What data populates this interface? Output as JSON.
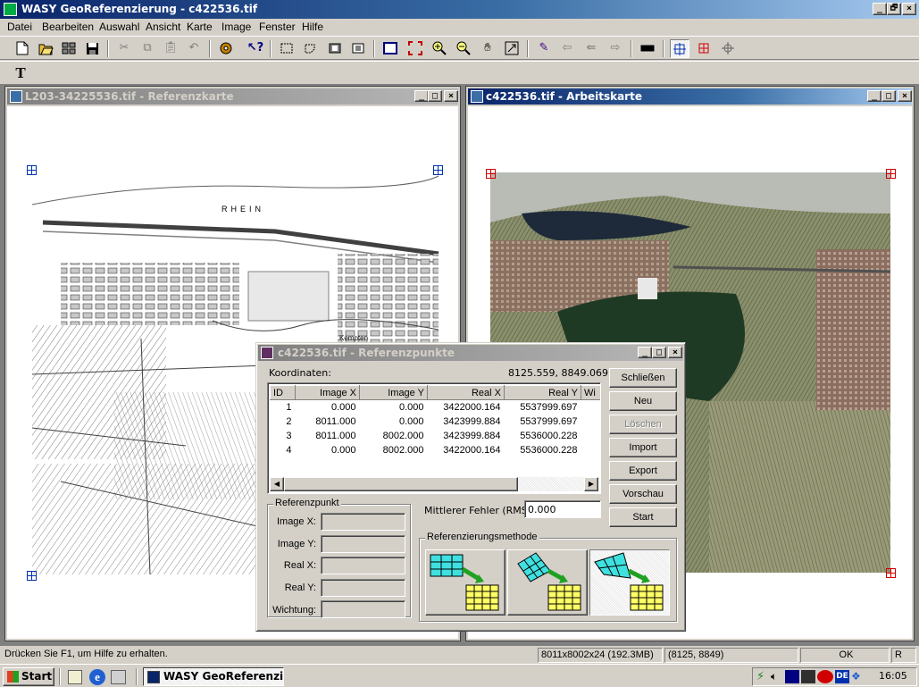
{
  "app": {
    "title": "WASY GeoReferenzierung - c422536.tif",
    "caption_buttons": [
      "_",
      "🗗",
      "×"
    ]
  },
  "menu": [
    "Datei",
    "Bearbeiten",
    "Auswahl",
    "Ansicht",
    "Karte",
    "Image",
    "Fenster",
    "Hilfe"
  ],
  "toolbar": {
    "icons": [
      "new-file-icon",
      "open-folder-icon",
      "layout-icon",
      "save-icon",
      "cut-icon",
      "copy-icon",
      "paste-icon",
      "undo-icon",
      "settings-icon",
      "help-cursor-icon",
      "rect-select-icon",
      "lasso-select-icon",
      "select-in-icon",
      "select-out-icon",
      "fit-window-icon",
      "full-extent-icon",
      "zoom-in-icon",
      "zoom-out-icon",
      "pan-hand-icon",
      "zoom-box-icon",
      "pen-icon",
      "back-icon",
      "back-all-icon",
      "forward-icon",
      "ruler-icon",
      "georef-point-icon",
      "red-point-icon",
      "crosshair-icon"
    ],
    "text_tool_label": "T"
  },
  "reference_window": {
    "title": "L203-34225536.tif - Referenzkarte",
    "map_label": "RHEIN",
    "map_label_2": "Kempten"
  },
  "work_window": {
    "title": "c422536.tif - Arbeitskarte"
  },
  "dialog": {
    "title": "c422536.tif - Referenzpunkte",
    "koordinaten_label": "Koordinaten:",
    "koordinaten_value": "8125.559, 8849.069",
    "columns": [
      "ID",
      "Image X",
      "Image Y",
      "Real X",
      "Real Y",
      "Wi"
    ],
    "rows": [
      [
        "1",
        "0.000",
        "0.000",
        "3422000.164",
        "5537999.697"
      ],
      [
        "2",
        "8011.000",
        "0.000",
        "3423999.884",
        "5537999.697"
      ],
      [
        "3",
        "8011.000",
        "8002.000",
        "3423999.884",
        "5536000.228"
      ],
      [
        "4",
        "0.000",
        "8002.000",
        "3422000.164",
        "5536000.228"
      ]
    ],
    "buttons": {
      "schliessen": "Schließen",
      "neu": "Neu",
      "loeschen": "Löschen",
      "import": "Import",
      "export": "Export",
      "vorschau": "Vorschau",
      "start": "Start"
    },
    "referenzpunkt": {
      "group_label": "Referenzpunkt",
      "image_x": "Image X:",
      "image_y": "Image Y:",
      "real_x": "Real X:",
      "real_y": "Real Y:",
      "wichtung": "Wichtung:"
    },
    "rms_label": "Mittlerer Fehler (RMS):",
    "rms_value": "0.000",
    "method_label": "Referenzierungsmethode"
  },
  "status": {
    "help": "Drücken Sie F1, um Hilfe zu erhalten.",
    "image_info": "8011x8002x24 (192.3MB)",
    "coords": "(8125, 8849)",
    "ok": "OK",
    "r": "R"
  },
  "taskbar": {
    "start": "Start",
    "task": "WASY GeoReferenzier...",
    "clock": "16:05",
    "lang": "DE"
  },
  "colors": {
    "title_active": "#0a246a",
    "title_gradient_end": "#a6caf0",
    "face": "#d4d0c8",
    "marker_blue": "#0030b0",
    "marker_red": "#d00000"
  }
}
